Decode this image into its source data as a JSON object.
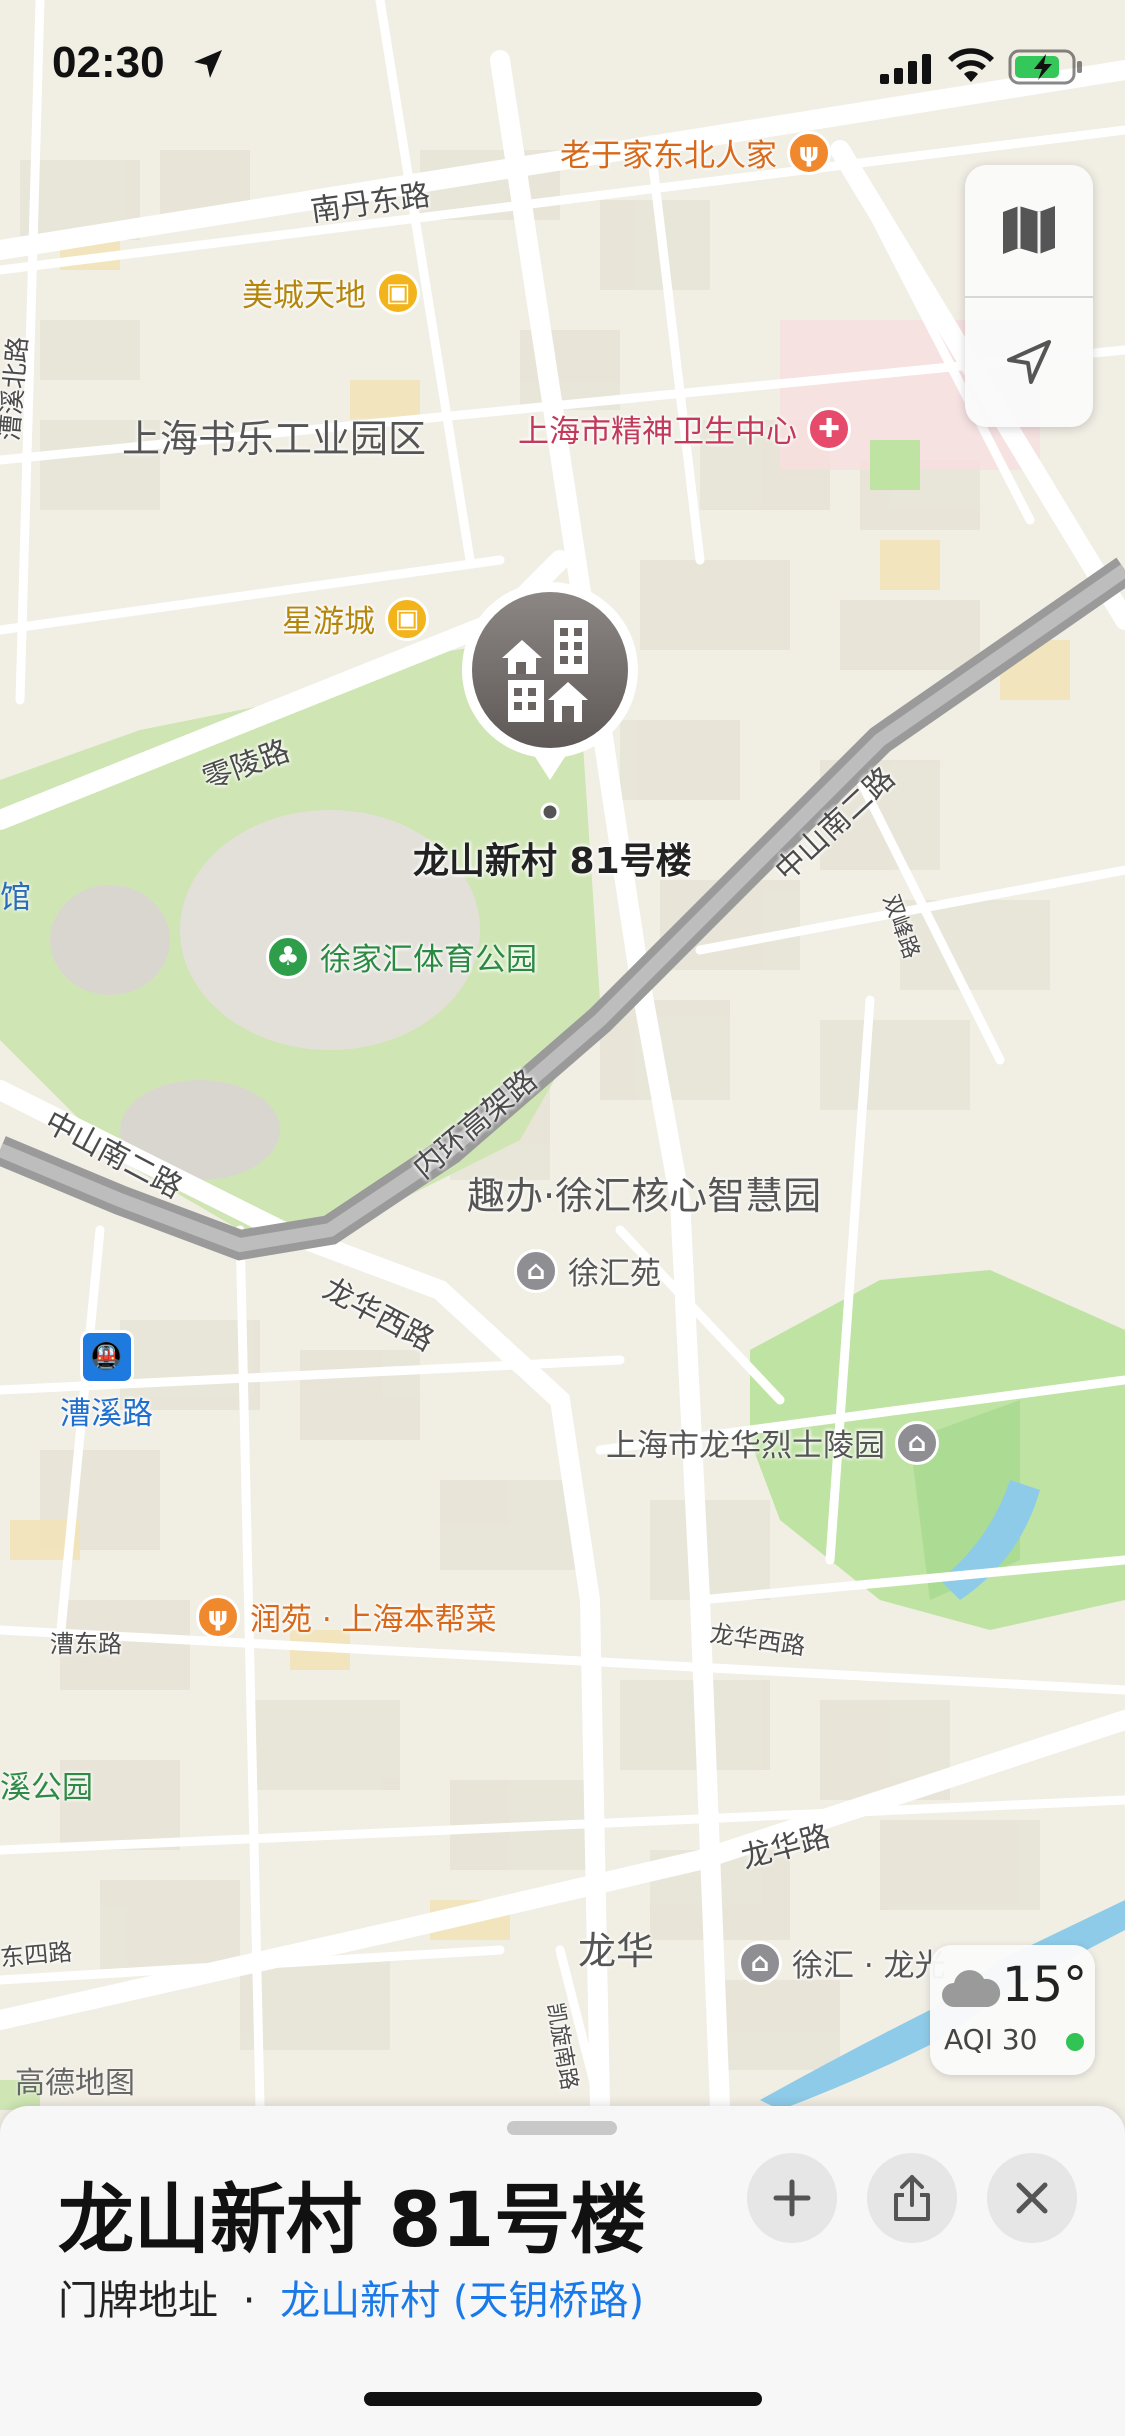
{
  "status_bar": {
    "time": "02:30"
  },
  "map": {
    "watermark": "高德地图",
    "roads": {
      "nandan": "南丹东路",
      "lingling": "零陵路",
      "zhongshan_nan2_a": "中山南二路",
      "zhongshan_nan2_b": "中山南二路",
      "neihuan": "内环高架路",
      "longhua_west": "龙华西路",
      "longhua_west2": "龙华西路",
      "longhua": "龙华路",
      "caodong": "漕东路",
      "shuangfeng": "双峰路",
      "kaixuan": "凯旋南路",
      "caoxi_north": "漕溪北路",
      "dong_si": "东四路"
    },
    "areas": {
      "shule_park": "上海书乐工业园区",
      "qubang": "趣办·徐汇核心智慧园",
      "longhua_district": "龙华",
      "guan": "馆",
      "xiyuan": "溪公园"
    },
    "pois": {
      "laoyujia": "老于家东北人家",
      "meicheng": "美城天地",
      "mental_health": "上海市精神卫生中心",
      "xingyou": "星游城",
      "xujiahui_park": "徐家汇体育公园",
      "xuhuiyuan": "徐汇苑",
      "caoxi_station": "漕溪路",
      "martyrs_cemetery": "上海市龙华烈士陵园",
      "runyuan": "润苑 · 上海本帮菜",
      "xuhui_long": "徐汇 · 龙光"
    },
    "selected_pin_label": "龙山新村 81号楼"
  },
  "weather": {
    "temp": "15°",
    "aqi": "AQI 30"
  },
  "sheet": {
    "title": "龙山新村 81号楼",
    "address_type": "门牌地址",
    "separator": "·",
    "address_link": "龙山新村 (天钥桥路)"
  },
  "colors": {
    "accent": "#1a79e8",
    "food": "#f0892e",
    "shopping": "#f2b31b",
    "hospital": "#e64b6b",
    "park": "#2e9e4b",
    "metro": "#1f7ae0",
    "residential": "#8e8e93",
    "highway": "#8f8f8f"
  }
}
